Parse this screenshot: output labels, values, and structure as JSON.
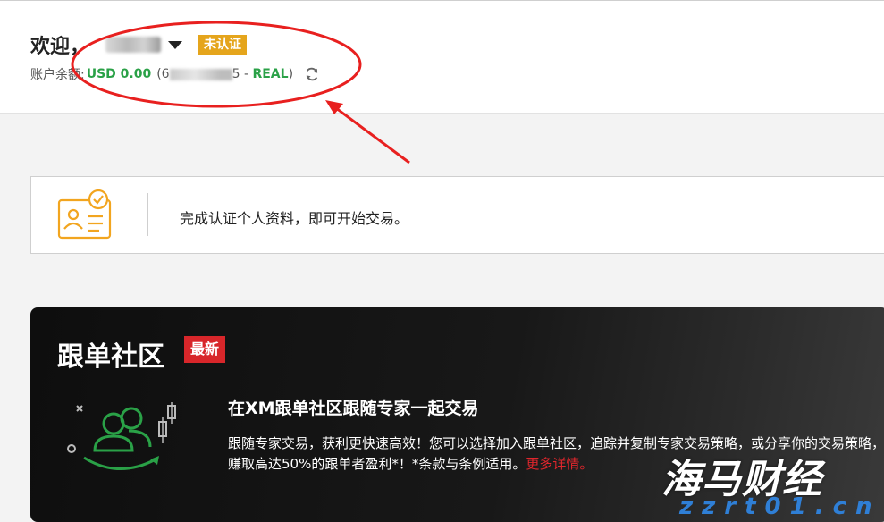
{
  "header": {
    "welcome": "欢迎，",
    "verify_badge": "未认证",
    "balance_label": "账户余额:",
    "balance_amount": "USD 0.00",
    "account_prefix": "(6",
    "account_suffix": "5 - ",
    "account_type": "REAL",
    "account_close": ")"
  },
  "notice": {
    "text": "完成认证个人资料，即可开始交易。",
    "icon": "id-card-check-icon"
  },
  "copy_trading": {
    "title": "跟单社区",
    "new_badge": "最新",
    "subtitle": "在XM跟单社区跟随专家一起交易",
    "body": "跟随专家交易，获利更快速高效！您可以选择加入跟单社区，追踪并复制专家交易策略，或分享你的交易策略，赚取高达50%的跟单者盈利*！*条款与条例适用。",
    "more_link": "更多详情。",
    "icon": "community-traders-icon"
  },
  "watermark": {
    "main": "海马财经",
    "sub": "zzrt01.cn"
  },
  "colors": {
    "balance_green": "#2aa147",
    "badge_orange": "#e5a51c",
    "badge_red": "#d8262a",
    "icon_orange": "#f2a51f",
    "icon_green": "#2aa147",
    "annotation_red": "#e8201f"
  }
}
